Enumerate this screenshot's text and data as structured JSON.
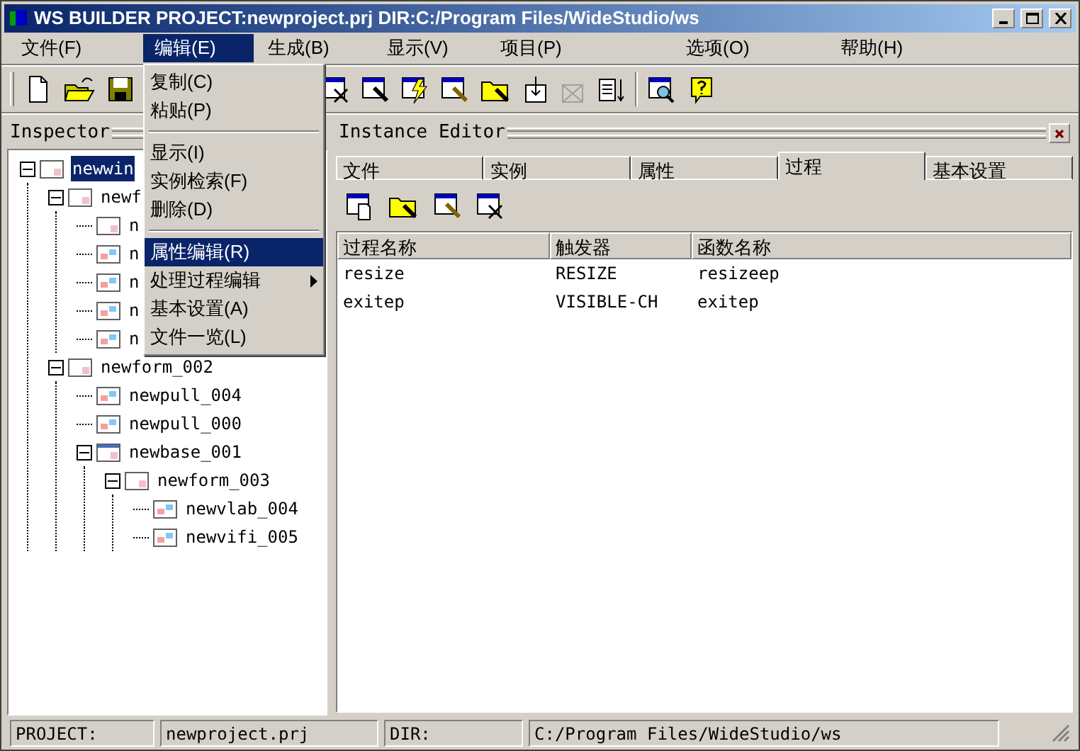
{
  "window": {
    "title": "WS BUILDER PROJECT:newproject.prj DIR:C:/Program Files/WideStudio/ws"
  },
  "menubar": [
    {
      "label": "文件(F)",
      "selected": false
    },
    {
      "label": "编辑(E)",
      "selected": true
    },
    {
      "label": "生成(B)",
      "selected": false
    },
    {
      "label": "显示(V)",
      "selected": false
    },
    {
      "label": "项目(P)",
      "selected": false
    },
    {
      "label": "选项(O)",
      "selected": false
    },
    {
      "label": "帮助(H)",
      "selected": false
    }
  ],
  "edit_menu": [
    {
      "kind": "item",
      "label": "复制(C)",
      "selected": false
    },
    {
      "kind": "item",
      "label": "粘贴(P)",
      "selected": false
    },
    {
      "kind": "separator"
    },
    {
      "kind": "item",
      "label": "显示(I)",
      "selected": false
    },
    {
      "kind": "item",
      "label": "实例检索(F)",
      "selected": false
    },
    {
      "kind": "item",
      "label": "删除(D)",
      "selected": false
    },
    {
      "kind": "separator"
    },
    {
      "kind": "item",
      "label": "属性编辑(R)",
      "selected": true
    },
    {
      "kind": "submenu",
      "label": "处理过程编辑",
      "selected": false
    },
    {
      "kind": "item",
      "label": "基本设置(A)",
      "selected": false
    },
    {
      "kind": "item",
      "label": "文件一览(L)",
      "selected": false
    }
  ],
  "inspector": {
    "title": "Inspector",
    "tree": [
      {
        "label": "newwin",
        "kind": "form",
        "selected": true,
        "expanded": true,
        "children": [
          {
            "label": "newf",
            "kind": "form",
            "selected": false,
            "expanded": true,
            "children": [
              {
                "label": "n",
                "kind": "form",
                "selected": false
              },
              {
                "label": "n",
                "kind": "widget",
                "selected": false
              },
              {
                "label": "n",
                "kind": "widget",
                "selected": false
              },
              {
                "label": "n",
                "kind": "widget",
                "selected": false
              },
              {
                "label": "n",
                "kind": "widget",
                "selected": false
              }
            ]
          },
          {
            "label": "newform_002",
            "kind": "form",
            "selected": false,
            "expanded": true,
            "children": [
              {
                "label": "newpull_004",
                "kind": "widget",
                "selected": false
              },
              {
                "label": "newpull_000",
                "kind": "widget",
                "selected": false
              },
              {
                "label": "newbase_001",
                "kind": "base",
                "selected": false,
                "expanded": true,
                "children": [
                  {
                    "label": "newform_003",
                    "kind": "form",
                    "selected": false,
                    "expanded": true,
                    "children": [
                      {
                        "label": "newvlab_004",
                        "kind": "widget",
                        "selected": false
                      },
                      {
                        "label": "newvifi_005",
                        "kind": "widget",
                        "selected": false
                      }
                    ]
                  }
                ]
              }
            ]
          }
        ]
      }
    ]
  },
  "instance_editor": {
    "title": "Instance Editor",
    "tabs": [
      {
        "label": "文件",
        "selected": false
      },
      {
        "label": "实例",
        "selected": false
      },
      {
        "label": "属性",
        "selected": false
      },
      {
        "label": "过程",
        "selected": true
      },
      {
        "label": "基本设置",
        "selected": false
      }
    ],
    "table": {
      "columns": [
        "过程名称",
        "触发器",
        "函数名称"
      ],
      "rows": [
        [
          "resize",
          "RESIZE",
          "resizeep"
        ],
        [
          "exitep",
          "VISIBLE-CH",
          "exitep"
        ]
      ]
    }
  },
  "status_bar": [
    "PROJECT:",
    "newproject.prj",
    "DIR:",
    "C:/Program Files/WideStudio/ws"
  ]
}
